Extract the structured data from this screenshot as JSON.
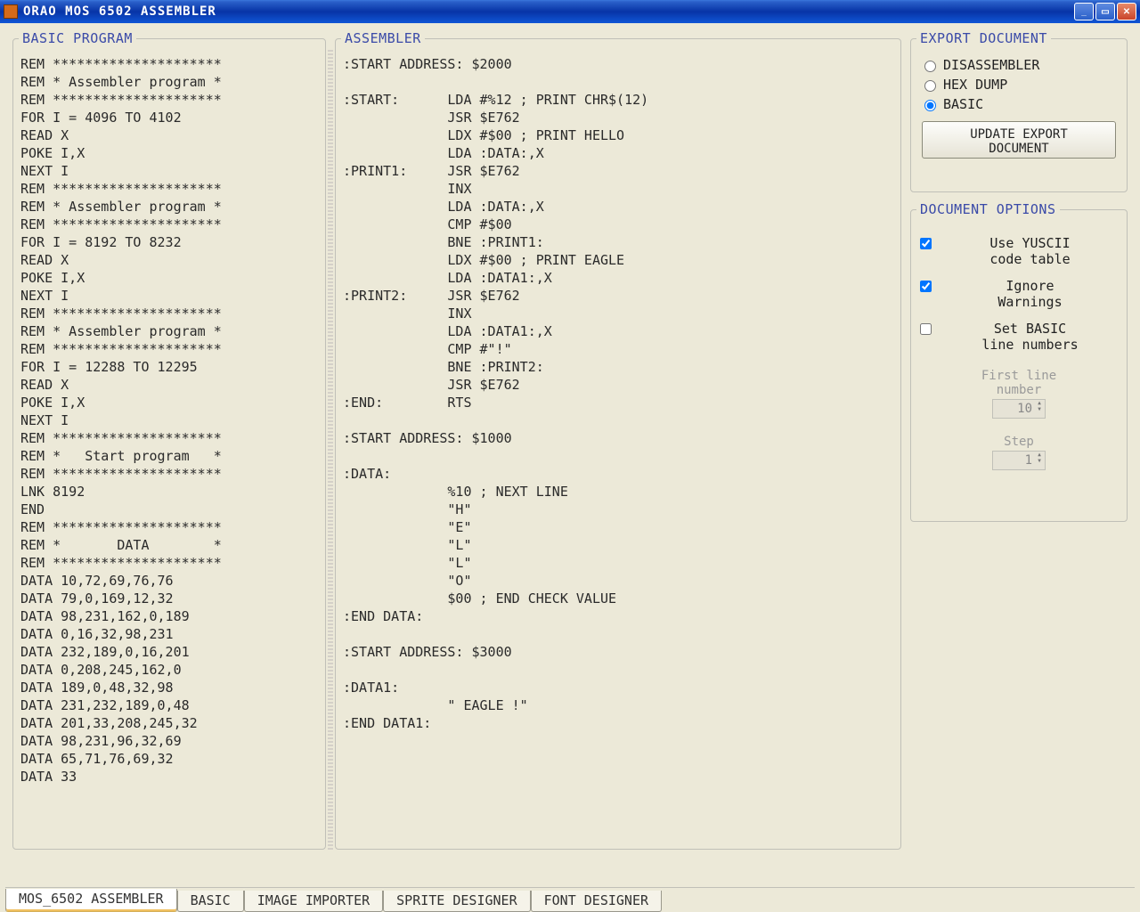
{
  "window": {
    "title": "ORAO  MOS 6502 ASSEMBLER"
  },
  "panels": {
    "basic_legend": "BASIC PROGRAM",
    "asm_legend": "ASSEMBLER",
    "export_legend": "EXPORT DOCUMENT",
    "docopt_legend": "DOCUMENT OPTIONS"
  },
  "basic_code": "REM *********************\nREM * Assembler program *\nREM *********************\nFOR I = 4096 TO 4102\nREAD X\nPOKE I,X\nNEXT I\nREM *********************\nREM * Assembler program *\nREM *********************\nFOR I = 8192 TO 8232\nREAD X\nPOKE I,X\nNEXT I\nREM *********************\nREM * Assembler program *\nREM *********************\nFOR I = 12288 TO 12295\nREAD X\nPOKE I,X\nNEXT I\nREM *********************\nREM *   Start program   *\nREM *********************\nLNK 8192\nEND\nREM *********************\nREM *       DATA        *\nREM *********************\nDATA 10,72,69,76,76\nDATA 79,0,169,12,32\nDATA 98,231,162,0,189\nDATA 0,16,32,98,231\nDATA 232,189,0,16,201\nDATA 0,208,245,162,0\nDATA 189,0,48,32,98\nDATA 231,232,189,0,48\nDATA 201,33,208,245,32\nDATA 98,231,96,32,69\nDATA 65,71,76,69,32\nDATA 33",
  "asm_code": ":START ADDRESS: $2000\n\n:START:      LDA #%12 ; PRINT CHR$(12)\n             JSR $E762\n             LDX #$00 ; PRINT HELLO\n             LDA :DATA:,X\n:PRINT1:     JSR $E762\n             INX\n             LDA :DATA:,X\n             CMP #$00\n             BNE :PRINT1:\n             LDX #$00 ; PRINT EAGLE\n             LDA :DATA1:,X\n:PRINT2:     JSR $E762\n             INX\n             LDA :DATA1:,X\n             CMP #\"!\"\n             BNE :PRINT2:\n             JSR $E762\n:END:        RTS\n\n:START ADDRESS: $1000\n\n:DATA:\n             %10 ; NEXT LINE\n             \"H\"\n             \"E\"\n             \"L\"\n             \"L\"\n             \"O\"\n             $00 ; END CHECK VALUE\n:END DATA:\n\n:START ADDRESS: $3000\n\n:DATA1:\n             \" EAGLE !\"\n:END DATA1:",
  "export": {
    "radio_disassembler": "DISASSEMBLER",
    "radio_hexdump": "HEX DUMP",
    "radio_basic": "BASIC",
    "selected": "basic",
    "button": "UPDATE EXPORT\nDOCUMENT"
  },
  "docopts": {
    "use_yuscii": {
      "label": "Use YUSCII\ncode table",
      "checked": true
    },
    "ignore_warn": {
      "label": "Ignore\nWarnings",
      "checked": true
    },
    "set_linenums": {
      "label": "Set BASIC\nline numbers",
      "checked": false
    },
    "first_line": {
      "label": "First line\nnumber",
      "value": "10"
    },
    "step": {
      "label": "Step",
      "value": "1"
    }
  },
  "tabs": [
    {
      "label": "MOS_6502 ASSEMBLER",
      "active": true
    },
    {
      "label": "BASIC",
      "active": false
    },
    {
      "label": "IMAGE IMPORTER",
      "active": false
    },
    {
      "label": "SPRITE DESIGNER",
      "active": false
    },
    {
      "label": "FONT DESIGNER",
      "active": false
    }
  ]
}
